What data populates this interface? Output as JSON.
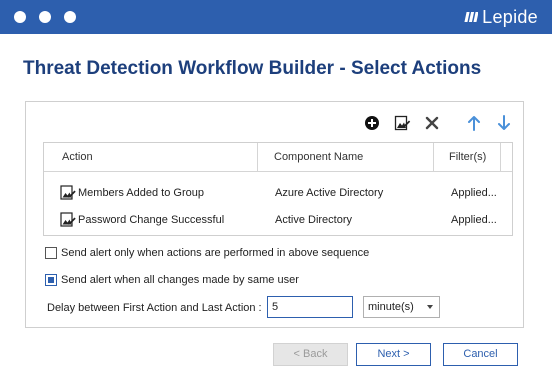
{
  "brand": {
    "name": "Lepide"
  },
  "page": {
    "title": "Threat Detection Workflow Builder - Select Actions"
  },
  "toolbar": {
    "icons": [
      "add-icon",
      "edit-icon",
      "delete-icon",
      "move-up-icon",
      "move-down-icon"
    ]
  },
  "table": {
    "columns": [
      "Action",
      "Component Name",
      "Filter(s)"
    ],
    "rows": [
      {
        "action": "Members Added to Group",
        "component": "Azure Active Directory",
        "filters": "Applied..."
      },
      {
        "action": "Password Change Successful",
        "component": "Active Directory",
        "filters": "Applied..."
      }
    ]
  },
  "options": {
    "sequence_label": "Send alert only when actions are performed in above sequence",
    "sequence_checked": false,
    "same_user_label": "Send alert when all changes made by same user",
    "same_user_checked": true
  },
  "delay": {
    "label": "Delay between First Action and Last Action :",
    "value": "5",
    "unit": "minute(s)"
  },
  "buttons": {
    "back": "< Back",
    "next": "Next >",
    "cancel": "Cancel"
  },
  "colors": {
    "primary": "#2d5fae",
    "heading": "#1d3f7c",
    "toolbar_arrows": "#4a90d9"
  }
}
